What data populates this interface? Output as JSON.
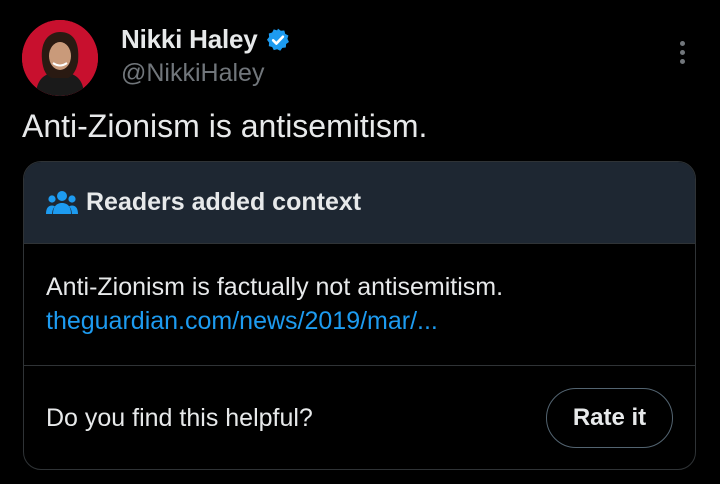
{
  "author": {
    "display_name": "Nikki Haley",
    "handle": "@NikkiHaley",
    "verified": true,
    "avatar_icon": "profile-photo"
  },
  "post": {
    "text": "Anti-Zionism is antisemitism."
  },
  "community_note": {
    "title": "Readers added context",
    "title_icon": "people-icon",
    "note": "Anti-Zionism is factually not antisemitism.",
    "link": "theguardian.com/news/2019/mar/...",
    "helpful_prompt": "Do you find this helpful?",
    "rate_button": "Rate it"
  },
  "colors": {
    "background": "#000000",
    "text": "#e7e9ea",
    "muted": "#71767b",
    "link": "#1d9bf0",
    "note_header_bg": "#1e2732",
    "border": "#2f3336"
  }
}
